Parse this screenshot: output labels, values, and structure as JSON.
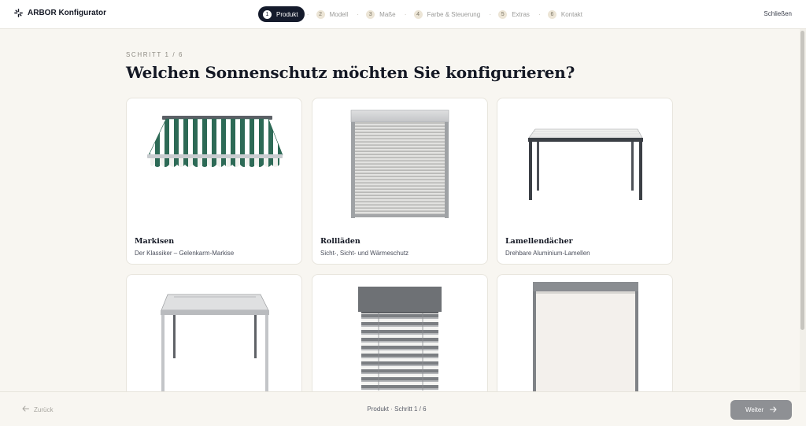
{
  "header": {
    "app_title": "ARBOR Konfigurator",
    "close_label": "Schließen",
    "steps": [
      {
        "num": "1",
        "label": "Produkt"
      },
      {
        "num": "2",
        "label": "Modell"
      },
      {
        "num": "3",
        "label": "Maße"
      },
      {
        "num": "4",
        "label": "Farbe & Steuerung"
      },
      {
        "num": "5",
        "label": "Extras"
      },
      {
        "num": "6",
        "label": "Kontakt"
      }
    ],
    "active_step": "1"
  },
  "main": {
    "kicker": "SCHRITT 1 / 6",
    "headline": "Welchen Sonnenschutz möchten Sie konfigurieren?",
    "products": [
      {
        "title": "Markisen",
        "desc": "Der Klassiker – Gelenkarm-Markise",
        "icon": "awning-icon"
      },
      {
        "title": "Rollläden",
        "desc": "Sicht-, Sicht- und Wärmeschutz",
        "icon": "roller-shutter-icon"
      },
      {
        "title": "Lamellendächer",
        "desc": "Drehbare Aluminium-Lamellen",
        "icon": "pergola-icon"
      },
      {
        "title": "",
        "desc": "",
        "icon": "canopy-icon"
      },
      {
        "title": "",
        "desc": "",
        "icon": "venetian-blind-icon"
      },
      {
        "title": "",
        "desc": "",
        "icon": "screen-blind-icon"
      }
    ]
  },
  "footer": {
    "back_label": "Zurück",
    "status": "Produkt · Schritt 1 / 6",
    "next_label": "Weiter"
  },
  "colors": {
    "accent_dark": "#151b2c",
    "background": "#f8f6f1",
    "awning_green": "#2d6a56"
  }
}
